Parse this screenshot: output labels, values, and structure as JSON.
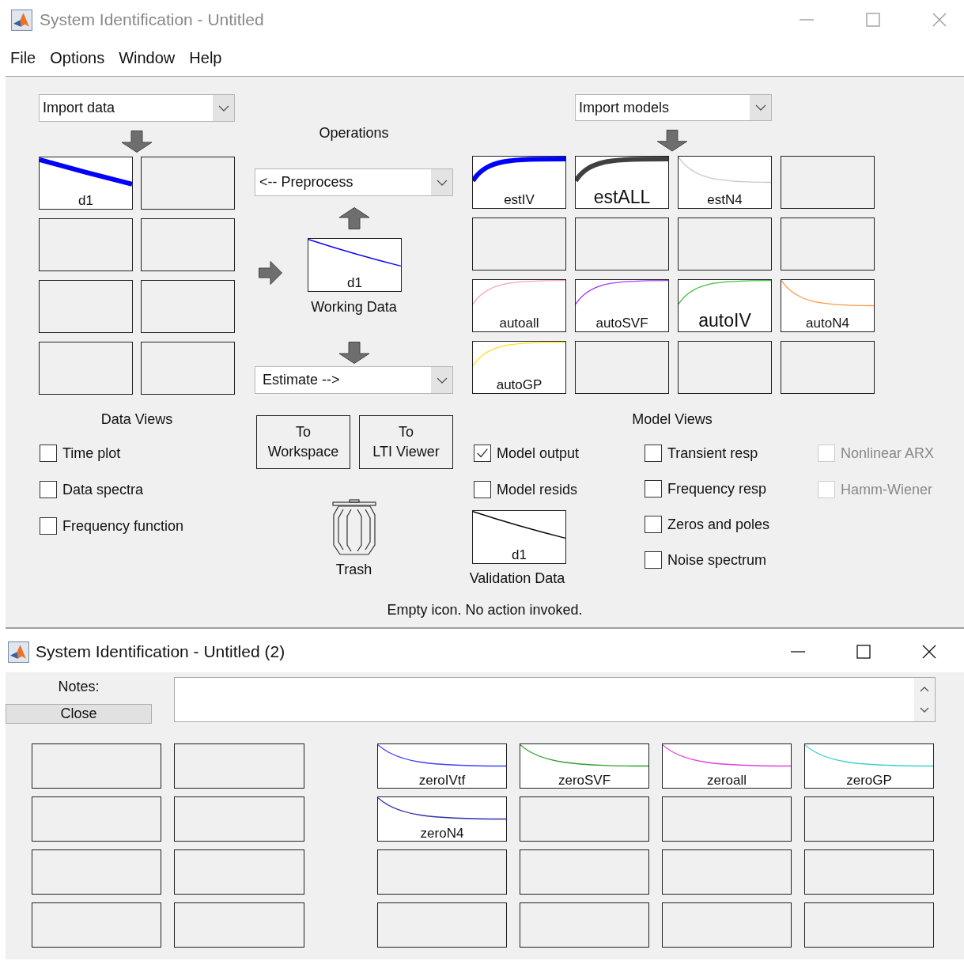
{
  "main_window": {
    "title": "System Identification - Untitled",
    "menu": [
      {
        "label": "File"
      },
      {
        "label": "Options"
      },
      {
        "label": "Window"
      },
      {
        "label": "Help"
      }
    ],
    "data_import": "Import data",
    "data_boards": [
      {
        "kind": "data",
        "label": "d1",
        "color": "#0000ff",
        "active": true,
        "emphasized": false
      },
      {
        "kind": "empty"
      },
      {
        "kind": "empty"
      },
      {
        "kind": "empty"
      },
      {
        "kind": "empty"
      },
      {
        "kind": "empty"
      },
      {
        "kind": "empty"
      },
      {
        "kind": "empty"
      }
    ],
    "operations": {
      "title": "Operations",
      "preprocess": "<-- Preprocess",
      "working_data": {
        "label": "d1",
        "caption": "Working Data",
        "color": "#0000ff"
      },
      "estimate": "Estimate -->",
      "buttons": [
        {
          "lines": [
            "To",
            "Workspace"
          ]
        },
        {
          "lines": [
            "To",
            "LTI Viewer"
          ]
        }
      ],
      "trash": "Trash"
    },
    "model_import": "Import models",
    "model_boards": [
      {
        "kind": "rise",
        "label": "estIV",
        "color": "#0000ff",
        "active": true,
        "emphasized": false
      },
      {
        "kind": "rise",
        "label": "estALL",
        "color": "#404040",
        "active": true,
        "emphasized": true
      },
      {
        "kind": "decay",
        "label": "estN4",
        "color": "#c8c8c8",
        "active": false,
        "emphasized": false
      },
      {
        "kind": "empty"
      },
      {
        "kind": "empty"
      },
      {
        "kind": "empty"
      },
      {
        "kind": "empty"
      },
      {
        "kind": "empty"
      },
      {
        "kind": "rise",
        "label": "autoall",
        "color": "#f4a6b8",
        "active": false,
        "emphasized": false
      },
      {
        "kind": "rise",
        "label": "autoSVF",
        "color": "#a040ff",
        "active": false,
        "emphasized": false
      },
      {
        "kind": "rise",
        "label": "autoIV",
        "color": "#40c040",
        "active": false,
        "emphasized": true
      },
      {
        "kind": "decay",
        "label": "autoN4",
        "color": "#ff9a40",
        "active": false,
        "emphasized": false
      },
      {
        "kind": "rise",
        "label": "autoGP",
        "color": "#ffe020",
        "active": false,
        "emphasized": false
      },
      {
        "kind": "empty"
      },
      {
        "kind": "empty"
      },
      {
        "kind": "empty"
      }
    ],
    "data_views": {
      "title": "Data Views",
      "options": [
        {
          "label": "Time plot",
          "checked": false,
          "disabled": false
        },
        {
          "label": "Data spectra",
          "checked": false,
          "disabled": false
        },
        {
          "label": "Frequency function",
          "checked": false,
          "disabled": false
        }
      ]
    },
    "model_views": {
      "title": "Model Views",
      "columns": [
        [
          {
            "label": "Model output",
            "checked": true,
            "disabled": false
          },
          {
            "label": "Model resids",
            "checked": false,
            "disabled": false
          }
        ],
        [
          {
            "label": "Transient resp",
            "checked": false,
            "disabled": false
          },
          {
            "label": "Frequency resp",
            "checked": false,
            "disabled": false
          },
          {
            "label": "Zeros and poles",
            "checked": false,
            "disabled": false
          },
          {
            "label": "Noise spectrum",
            "checked": false,
            "disabled": false
          }
        ],
        [
          {
            "label": "Nonlinear ARX",
            "checked": false,
            "disabled": true
          },
          {
            "label": "Hamm-Wiener",
            "checked": false,
            "disabled": true
          }
        ]
      ],
      "validation_data": {
        "label": "d1",
        "caption": "Validation Data",
        "color": "#000000"
      }
    },
    "status": "Empty icon. No action invoked."
  },
  "second_window": {
    "title": "System Identification - Untitled (2)",
    "notes_label": "Notes:",
    "close_button": "Close",
    "data_boards": [
      {
        "kind": "empty"
      },
      {
        "kind": "empty"
      },
      {
        "kind": "empty"
      },
      {
        "kind": "empty"
      },
      {
        "kind": "empty"
      },
      {
        "kind": "empty"
      },
      {
        "kind": "empty"
      },
      {
        "kind": "empty"
      }
    ],
    "model_boards": [
      {
        "kind": "decay",
        "label": "zeroIVtf",
        "color": "#4040ff",
        "active": false,
        "emphasized": false
      },
      {
        "kind": "decay",
        "label": "zeroSVF",
        "color": "#30a030",
        "active": false,
        "emphasized": false
      },
      {
        "kind": "decay",
        "label": "zeroall",
        "color": "#e040e0",
        "active": false,
        "emphasized": false
      },
      {
        "kind": "decay",
        "label": "zeroGP",
        "color": "#40d0d0",
        "active": false,
        "emphasized": false
      },
      {
        "kind": "decay",
        "label": "zeroN4",
        "color": "#3030b0",
        "active": false,
        "emphasized": false
      },
      {
        "kind": "empty"
      },
      {
        "kind": "empty"
      },
      {
        "kind": "empty"
      },
      {
        "kind": "empty"
      },
      {
        "kind": "empty"
      },
      {
        "kind": "empty"
      },
      {
        "kind": "empty"
      },
      {
        "kind": "empty"
      },
      {
        "kind": "empty"
      },
      {
        "kind": "empty"
      },
      {
        "kind": "empty"
      }
    ]
  }
}
